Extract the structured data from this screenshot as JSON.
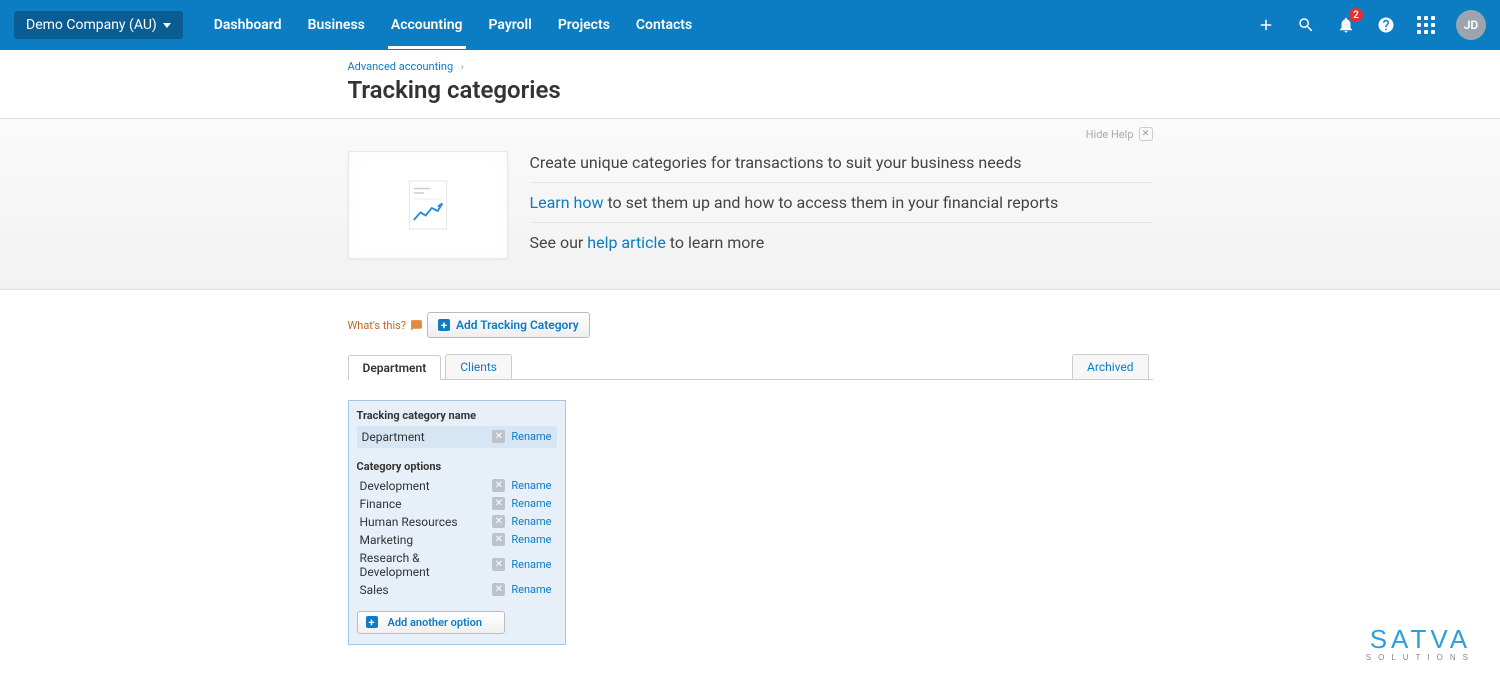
{
  "header": {
    "org": "Demo Company (AU)",
    "nav": [
      "Dashboard",
      "Business",
      "Accounting",
      "Payroll",
      "Projects",
      "Contacts"
    ],
    "active_nav_index": 2,
    "notifications_count": "2",
    "avatar_initials": "JD"
  },
  "breadcrumb": {
    "label": "Advanced accounting"
  },
  "page_title": "Tracking categories",
  "hide_help_label": "Hide Help",
  "help": {
    "line1": "Create unique categories for transactions to suit your business needs",
    "line2_link": "Learn how",
    "line2_rest": " to set them up and how to access them in your financial reports",
    "line3_pre": "See our ",
    "line3_link": "help article",
    "line3_rest": " to learn more"
  },
  "whats_this_label": "What's this?",
  "add_category_label": "Add Tracking Category",
  "tabs": {
    "items": [
      "Department",
      "Clients"
    ],
    "archived": "Archived"
  },
  "panel": {
    "name_section_label": "Tracking category name",
    "category_name": "Department",
    "rename_label": "Rename",
    "options_section_label": "Category options",
    "options": [
      "Development",
      "Finance",
      "Human Resources",
      "Marketing",
      "Research & Development",
      "Sales"
    ],
    "add_option_label": "Add another option"
  },
  "watermark": {
    "big": "SATVA",
    "small": "SOLUTIONS"
  }
}
